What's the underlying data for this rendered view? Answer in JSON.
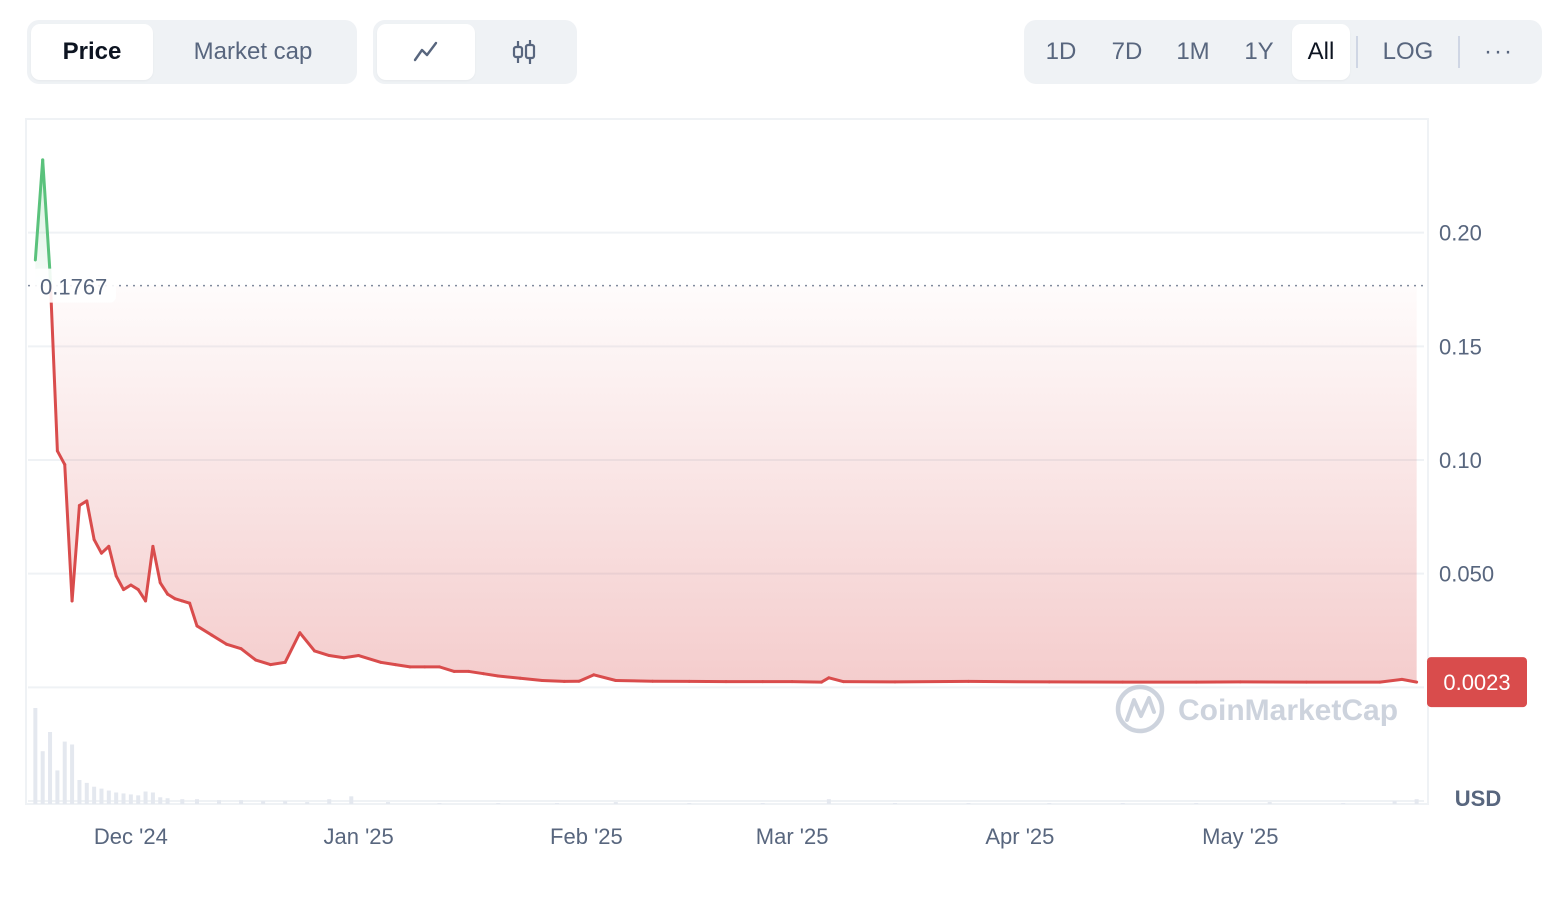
{
  "controls": {
    "type_tabs": [
      {
        "label": "Price",
        "active": true
      },
      {
        "label": "Market cap",
        "active": false
      }
    ],
    "style_tabs": [
      {
        "icon": "line-chart-icon",
        "active": true
      },
      {
        "icon": "candlestick-icon",
        "active": false
      }
    ],
    "range_tabs": [
      {
        "label": "1D",
        "active": false
      },
      {
        "label": "7D",
        "active": false
      },
      {
        "label": "1M",
        "active": false
      },
      {
        "label": "1Y",
        "active": false
      },
      {
        "label": "All",
        "active": true
      }
    ],
    "log_label": "LOG",
    "more_label": "···"
  },
  "watermark": "CoinMarketCap",
  "colors": {
    "down_line": "#d94c4c",
    "up_line": "#5ac27c",
    "current_badge": "#d94c4c",
    "grid": "#eff2f5",
    "axis_text": "#58667e"
  },
  "chart_data": {
    "type": "line",
    "title": "",
    "xlabel": "",
    "ylabel": "",
    "y_unit": "USD",
    "ylim": [
      -0.05,
      0.25
    ],
    "yticks": [
      {
        "value": 0.2,
        "label": "0.20"
      },
      {
        "value": 0.15,
        "label": "0.15"
      },
      {
        "value": 0.1,
        "label": "0.10"
      },
      {
        "value": 0.05,
        "label": "0.050"
      }
    ],
    "xlim": [
      "2024-11-17",
      "2025-05-26"
    ],
    "xticks": [
      {
        "date": "2024-12-01",
        "label": "Dec '24"
      },
      {
        "date": "2025-01-01",
        "label": "Jan '25"
      },
      {
        "date": "2025-02-01",
        "label": "Feb '25"
      },
      {
        "date": "2025-03-01",
        "label": "Mar '25"
      },
      {
        "date": "2025-04-01",
        "label": "Apr '25"
      },
      {
        "date": "2025-05-01",
        "label": "May '25"
      }
    ],
    "reference_price": {
      "value": 0.1767,
      "label": "0.1767"
    },
    "current_price": {
      "value": 0.0023,
      "label": "0.0023"
    },
    "grid": true,
    "series": [
      {
        "x": [
          "2024-11-18",
          "2024-11-19",
          "2024-11-20",
          "2024-11-21",
          "2024-11-22",
          "2024-11-23",
          "2024-11-24",
          "2024-11-25",
          "2024-11-26",
          "2024-11-27",
          "2024-11-28",
          "2024-11-29",
          "2024-11-30",
          "2024-12-01",
          "2024-12-02",
          "2024-12-03",
          "2024-12-04",
          "2024-12-05",
          "2024-12-06",
          "2024-12-07",
          "2024-12-08",
          "2024-12-09",
          "2024-12-10",
          "2024-12-12",
          "2024-12-14",
          "2024-12-16",
          "2024-12-18",
          "2024-12-20",
          "2024-12-22",
          "2024-12-24",
          "2024-12-26",
          "2024-12-28",
          "2024-12-30",
          "2025-01-01",
          "2025-01-04",
          "2025-01-06",
          "2025-01-08",
          "2025-01-10",
          "2025-01-12",
          "2025-01-14",
          "2025-01-16",
          "2025-01-18",
          "2025-01-20",
          "2025-01-23",
          "2025-01-26",
          "2025-01-29",
          "2025-01-31",
          "2025-02-02",
          "2025-02-05",
          "2025-02-10",
          "2025-02-15",
          "2025-02-20",
          "2025-02-25",
          "2025-03-01",
          "2025-03-05",
          "2025-03-06",
          "2025-03-08",
          "2025-03-15",
          "2025-03-25",
          "2025-04-05",
          "2025-04-15",
          "2025-04-25",
          "2025-05-01",
          "2025-05-10",
          "2025-05-20",
          "2025-05-23",
          "2025-05-25"
        ],
        "y": [
          0.188,
          0.232,
          0.182,
          0.104,
          0.098,
          0.038,
          0.08,
          0.082,
          0.065,
          0.059,
          0.062,
          0.049,
          0.043,
          0.045,
          0.043,
          0.038,
          0.062,
          0.046,
          0.041,
          0.039,
          0.038,
          0.037,
          0.027,
          0.023,
          0.019,
          0.017,
          0.012,
          0.01,
          0.011,
          0.024,
          0.016,
          0.014,
          0.013,
          0.014,
          0.011,
          0.01,
          0.009,
          0.009,
          0.009,
          0.007,
          0.007,
          0.006,
          0.005,
          0.004,
          0.003,
          0.0026,
          0.0027,
          0.0055,
          0.003,
          0.0027,
          0.0026,
          0.0025,
          0.0025,
          0.0025,
          0.0023,
          0.0042,
          0.0025,
          0.0024,
          0.0026,
          0.0024,
          0.0023,
          0.0023,
          0.0024,
          0.0023,
          0.0023,
          0.0035,
          0.0023
        ]
      }
    ],
    "volume": {
      "x": [
        "2024-11-18",
        "2024-11-19",
        "2024-11-20",
        "2024-11-21",
        "2024-11-22",
        "2024-11-23",
        "2024-11-24",
        "2024-11-25",
        "2024-11-26",
        "2024-11-27",
        "2024-11-28",
        "2024-11-29",
        "2024-11-30",
        "2024-12-01",
        "2024-12-02",
        "2024-12-03",
        "2024-12-04",
        "2024-12-05",
        "2024-12-06",
        "2024-12-08",
        "2024-12-10",
        "2024-12-13",
        "2024-12-16",
        "2024-12-19",
        "2024-12-22",
        "2024-12-25",
        "2024-12-28",
        "2024-12-31",
        "2025-01-05",
        "2025-01-12",
        "2025-01-20",
        "2025-01-28",
        "2025-02-05",
        "2025-02-15",
        "2025-02-25",
        "2025-03-06",
        "2025-03-15",
        "2025-03-25",
        "2025-04-05",
        "2025-04-15",
        "2025-04-25",
        "2025-05-05",
        "2025-05-15",
        "2025-05-22",
        "2025-05-25"
      ],
      "values": [
        100,
        55,
        75,
        35,
        65,
        62,
        25,
        22,
        18,
        16,
        14,
        12,
        11,
        10,
        9,
        13,
        12,
        7,
        6,
        5,
        5,
        4,
        4,
        3,
        3,
        2,
        5,
        8,
        2,
        1,
        1,
        1,
        2,
        1,
        1,
        5,
        1,
        1,
        1,
        1,
        1,
        2,
        1,
        3,
        5
      ]
    }
  }
}
